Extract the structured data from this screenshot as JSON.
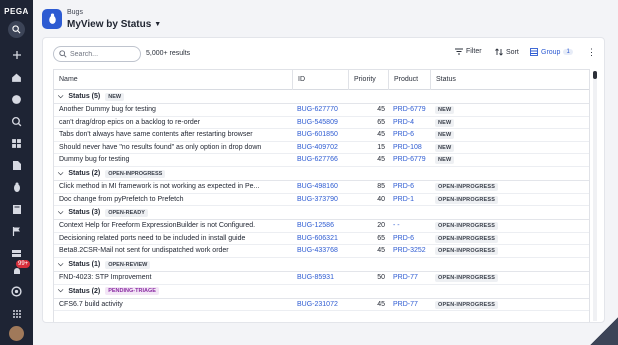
{
  "rail": {
    "brand": "PEGA",
    "notif_badge": "99+"
  },
  "header": {
    "breadcrumb": "Bugs",
    "title": "MyView by Status"
  },
  "toolbar": {
    "search_placeholder": "Search...",
    "results": "5,000+ results",
    "filter_label": "Filter",
    "sort_label": "Sort",
    "group_label": "Group",
    "group_count": "1"
  },
  "table": {
    "columns": [
      "Name",
      "ID",
      "Priority",
      "Product",
      "Status"
    ],
    "groups": [
      {
        "label": "Status (5)",
        "tag": "NEW",
        "tag_style": "plain",
        "rows": [
          {
            "name": "Another Dummy bug for testing",
            "id": "BUG-627770",
            "priority": "45",
            "product": "PRD-6779",
            "status": "NEW"
          },
          {
            "name": "can't drag/drop epics on a backlog to re-order",
            "id": "BUG-545809",
            "priority": "65",
            "product": "PRD-4",
            "status": "NEW"
          },
          {
            "name": "Tabs don't always have same contents after restarting browser",
            "id": "BUG-601850",
            "priority": "45",
            "product": "PRD-6",
            "status": "NEW"
          },
          {
            "name": "Should never have \"no results found\" as only option in drop down",
            "id": "BUG-409702",
            "priority": "15",
            "product": "PRD-108",
            "status": "NEW"
          },
          {
            "name": "Dummy bug for testing",
            "id": "BUG-627766",
            "priority": "45",
            "product": "PRD-6779",
            "status": "NEW"
          }
        ]
      },
      {
        "label": "Status (2)",
        "tag": "OPEN-INPROGRESS",
        "tag_style": "plain",
        "rows": [
          {
            "name": "Click method in MI framework is not working as expected in Pe...",
            "id": "BUG-498160",
            "priority": "85",
            "product": "PRD-6",
            "status": "OPEN-INPROGRESS"
          },
          {
            "name": "Doc change from pyPrefetch to Prefetch",
            "id": "BUG-373790",
            "priority": "40",
            "product": "PRD-1",
            "status": "OPEN-INPROGRESS"
          }
        ]
      },
      {
        "label": "Status (3)",
        "tag": "OPEN-READY",
        "tag_style": "plain",
        "rows": [
          {
            "name": "Context Help for Freeform ExpressionBuilder is not Configured.",
            "id": "BUG-12586",
            "priority": "20",
            "product": "- -",
            "status": "OPEN-INPROGRESS"
          },
          {
            "name": "Decisioning related ports need to be included in install guide",
            "id": "BUG-606321",
            "priority": "65",
            "product": "PRD-6",
            "status": "OPEN-INPROGRESS"
          },
          {
            "name": "Beta8.2CSR-Mail not sent for undispatched work order",
            "id": "BUG-433768",
            "priority": "45",
            "product": "PRD-3252",
            "status": "OPEN-INPROGRESS"
          }
        ]
      },
      {
        "label": "Status (1)",
        "tag": "OPEN-REVIEW",
        "tag_style": "plain",
        "rows": [
          {
            "name": "FND-4023: STP Improvement",
            "id": "BUG-85931",
            "priority": "50",
            "product": "PRD-77",
            "status": "OPEN-INPROGRESS"
          }
        ]
      },
      {
        "label": "Status (2)",
        "tag": "PENDING-TRIAGE",
        "tag_style": "pending",
        "rows": [
          {
            "name": "CFS6.7 build activity",
            "id": "BUG-231072",
            "priority": "45",
            "product": "PRD-77",
            "status": "OPEN-INPROGRESS"
          }
        ]
      }
    ]
  },
  "colors": {
    "accent": "#2d5bd2",
    "rail": "#1e2434",
    "pending_tag": "#8b2ca3"
  }
}
